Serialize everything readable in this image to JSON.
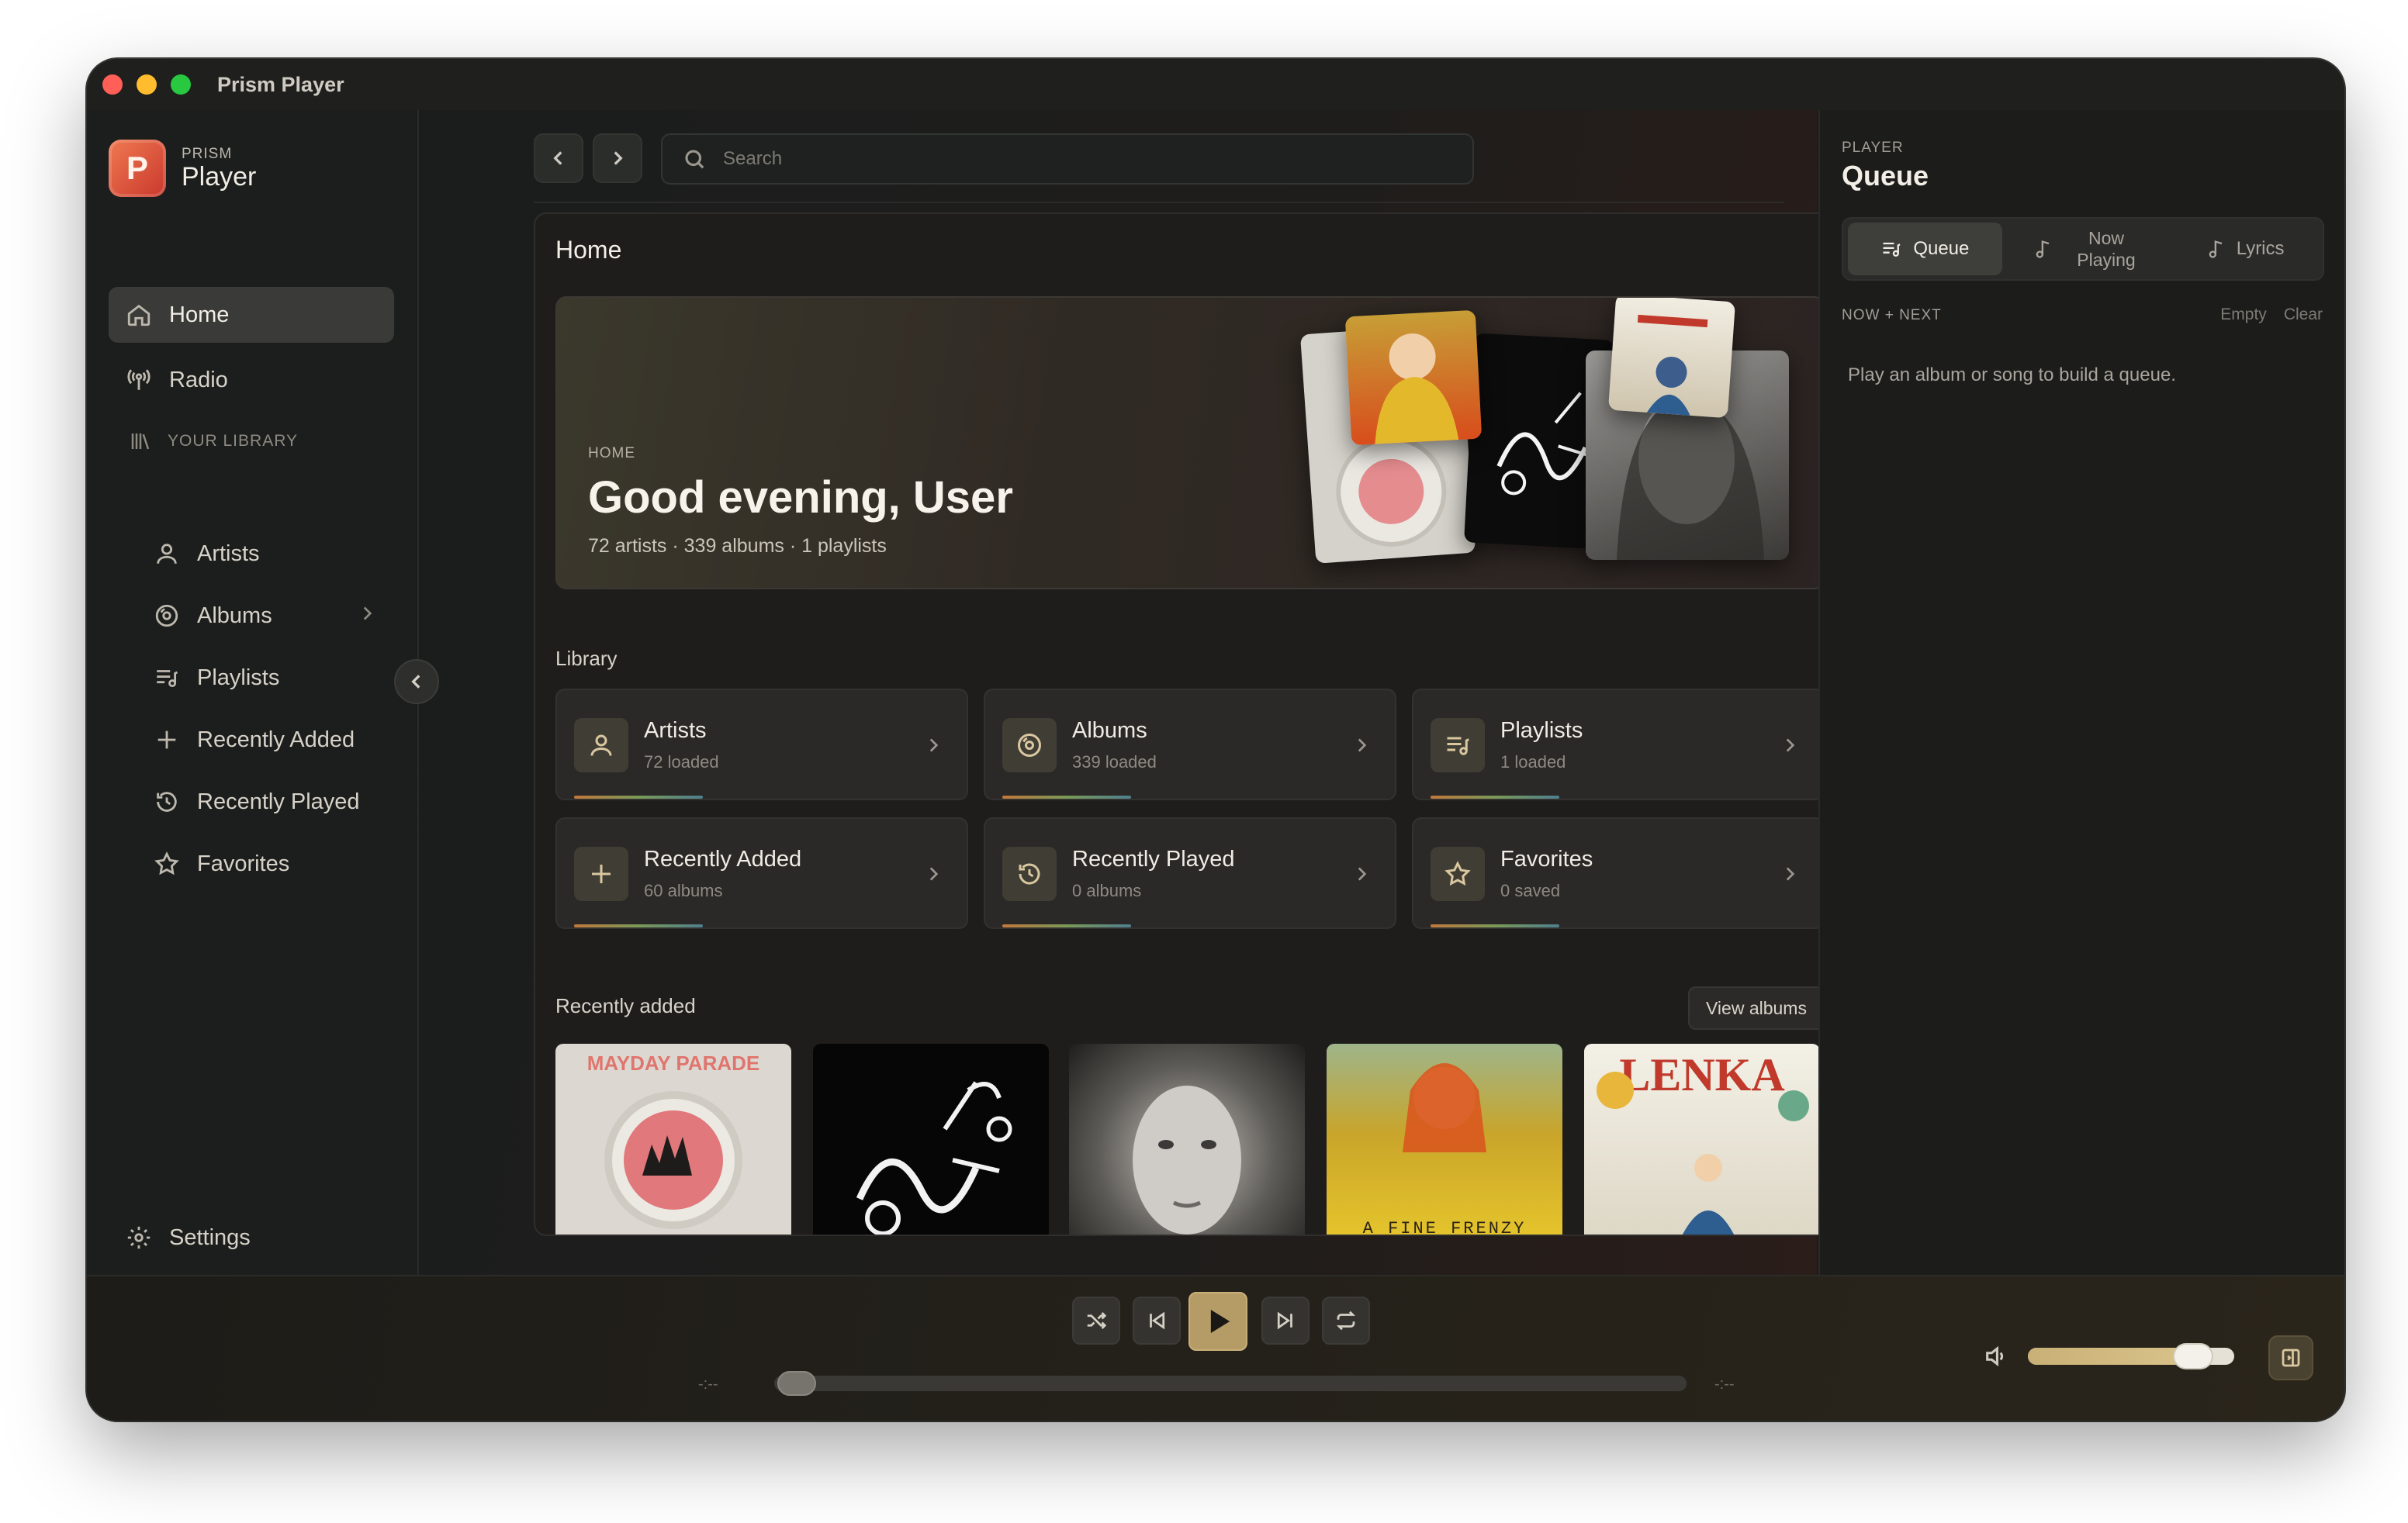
{
  "window": {
    "title": "Prism Player"
  },
  "brand": {
    "small": "PRISM",
    "big": "Player",
    "logo_letter": "P"
  },
  "sidebar": {
    "home": "Home",
    "radio": "Radio",
    "library_heading": "YOUR LIBRARY",
    "library_items": [
      "Artists",
      "Albums",
      "Playlists",
      "Recently Added",
      "Recently Played",
      "Favorites"
    ],
    "settings": "Settings"
  },
  "search": {
    "placeholder": "Search"
  },
  "main": {
    "page_title": "Home",
    "hero": {
      "eyebrow": "HOME",
      "greeting": "Good evening, User",
      "stats": "72 artists · 339 albums · 1 playlists"
    },
    "library_label": "Library",
    "cards": [
      {
        "title": "Artists",
        "subtitle": "72 loaded",
        "icon": "person-icon"
      },
      {
        "title": "Albums",
        "subtitle": "339 loaded",
        "icon": "disc-icon"
      },
      {
        "title": "Playlists",
        "subtitle": "1 loaded",
        "icon": "playlist-icon"
      },
      {
        "title": "Recently Added",
        "subtitle": "60 albums",
        "icon": "plus-icon"
      },
      {
        "title": "Recently Played",
        "subtitle": "0 albums",
        "icon": "history-icon"
      },
      {
        "title": "Favorites",
        "subtitle": "0 saved",
        "icon": "star-icon"
      }
    ],
    "recently_added_label": "Recently added",
    "view_albums": "View albums",
    "album_cover_text": [
      "MAYDAY PARADE",
      "",
      "",
      "A FINE FRENZY",
      "LENKA"
    ]
  },
  "right_panel": {
    "eyebrow": "PLAYER",
    "title": "Queue",
    "tabs": [
      "Queue",
      "Now Playing",
      "Lyrics"
    ],
    "active_tab": "Queue",
    "section": "NOW + NEXT",
    "empty_label": "Empty",
    "clear_label": "Clear",
    "hint": "Play an album or song to build a queue."
  },
  "player": {
    "time_elapsed": "-:--",
    "time_total": "-:--",
    "progress": 0,
    "volume": 0.8,
    "accent": "#b59b66"
  }
}
